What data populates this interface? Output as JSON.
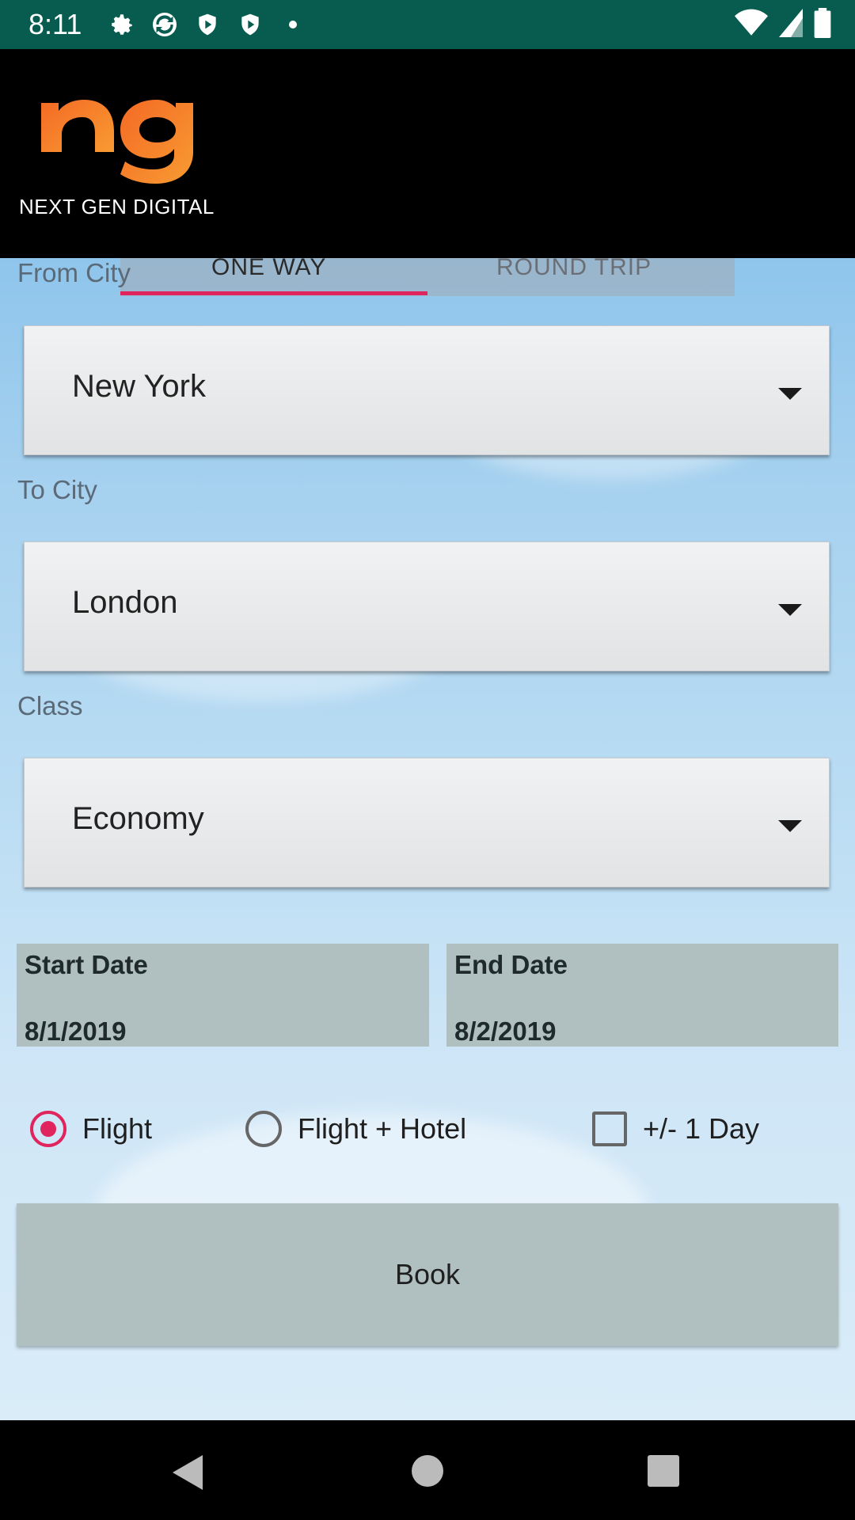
{
  "status_bar": {
    "time": "8:11",
    "icons": [
      "settings-icon",
      "sync-icon",
      "shield-play-icon",
      "shield-play-icon",
      "dot-icon"
    ],
    "right_icons": [
      "wifi-icon",
      "signal-icon",
      "battery-icon"
    ]
  },
  "app": {
    "logo_letters": "ng",
    "logo_text": "NEXT GEN DIGITAL",
    "brand_color": "#f47a2a"
  },
  "tabs": [
    {
      "label": "ONE WAY",
      "selected": true
    },
    {
      "label": "ROUND TRIP",
      "selected": false
    }
  ],
  "form": {
    "from_label": "From City",
    "from_value": "New York",
    "to_label": "To City",
    "to_value": "London",
    "class_label": "Class",
    "class_value": "Economy",
    "start_date_label": "Start Date",
    "start_date_value": "8/1/2019",
    "end_date_label": "End Date",
    "end_date_value": "8/2/2019",
    "options": {
      "flight": {
        "label": "Flight",
        "selected": true
      },
      "flight_hotel": {
        "label": "Flight + Hotel",
        "selected": false
      },
      "plus_minus_day": {
        "label": "+/- 1 Day",
        "checked": false
      }
    },
    "book_label": "Book"
  },
  "colors": {
    "accent": "#e0245e",
    "status_bar": "#075c4f",
    "date_box": "#b0bfbf"
  }
}
